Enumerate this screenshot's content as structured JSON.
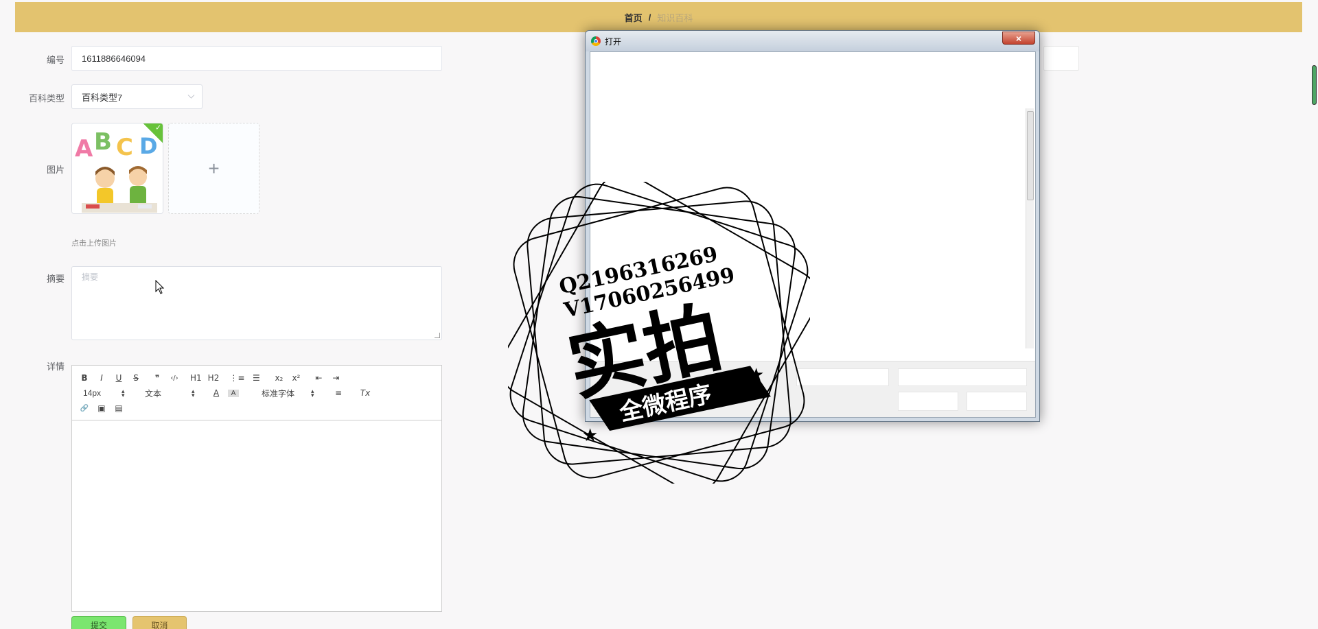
{
  "breadcrumb": {
    "home": "首页",
    "separator": "/",
    "current": "知识百科"
  },
  "form": {
    "id_label": "编号",
    "id_value": "1611886646094",
    "type_label": "百科类型",
    "type_value": "百科类型7",
    "image_label": "图片",
    "upload_hint": "点击上传图片",
    "upload_plus": "+",
    "summary_label": "摘要",
    "summary_placeholder": "摘要",
    "detail_label": "详情"
  },
  "editor": {
    "row1": [
      "B",
      "I",
      "U",
      "S",
      "❞",
      "‹/›",
      "H1",
      "H2",
      "⋮≡",
      "☰",
      "x₂",
      "x²",
      "⇤",
      "⇥"
    ],
    "font_size": "14px",
    "text_style": "文本",
    "font_family": "标准字体",
    "row2_icons": [
      "A",
      "A",
      "≡",
      "Tx"
    ],
    "row3": [
      "🔗",
      "▣",
      "▤"
    ]
  },
  "buttons": {
    "submit": "提交",
    "cancel": "取消"
  },
  "dialog": {
    "title": "打开",
    "close": "×"
  },
  "watermark": {
    "line1": "Q2196316269",
    "line2": "V17060256499",
    "big": "实拍",
    "banner": "全微程序"
  },
  "colors": {
    "header": "#e3c36f",
    "submit": "#7be66f",
    "cancel": "#e5c46f",
    "check": "#67c23a"
  }
}
